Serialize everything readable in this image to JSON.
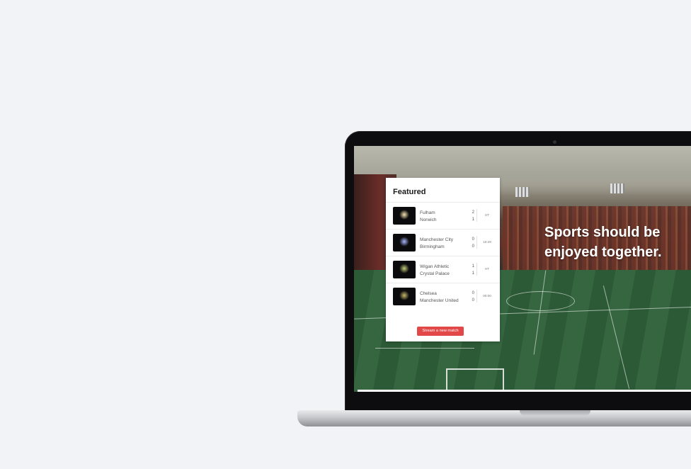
{
  "hero": {
    "line1": "Sports should be",
    "line2": "enjoyed together."
  },
  "featured": {
    "title": "Featured",
    "matches": [
      {
        "home": "Fulham",
        "away": "Norwich",
        "home_score": "2",
        "away_score": "1",
        "status": "HT",
        "thumb": "firework-thumbnail",
        "glow": "#f6e3b0"
      },
      {
        "home": "Manchester City",
        "away": "Birmingham",
        "home_score": "0",
        "away_score": "0",
        "status": "10:29",
        "thumb": "stadium-lights-thumbnail",
        "glow": "#a8b6ff"
      },
      {
        "home": "Wigan Athletic",
        "away": "Crystal Palace",
        "home_score": "1",
        "away_score": "1",
        "status": "HT",
        "thumb": "firework-thumbnail",
        "glow": "#c6d07a"
      },
      {
        "home": "Chelsea",
        "away": "Manchester United",
        "home_score": "0",
        "away_score": "0",
        "status": "00:00",
        "thumb": "firework-thumbnail",
        "glow": "#c7b86a"
      }
    ],
    "button_label": "Stream a new match"
  },
  "colors": {
    "accent": "#e24848",
    "background": "#f2f3f6"
  }
}
